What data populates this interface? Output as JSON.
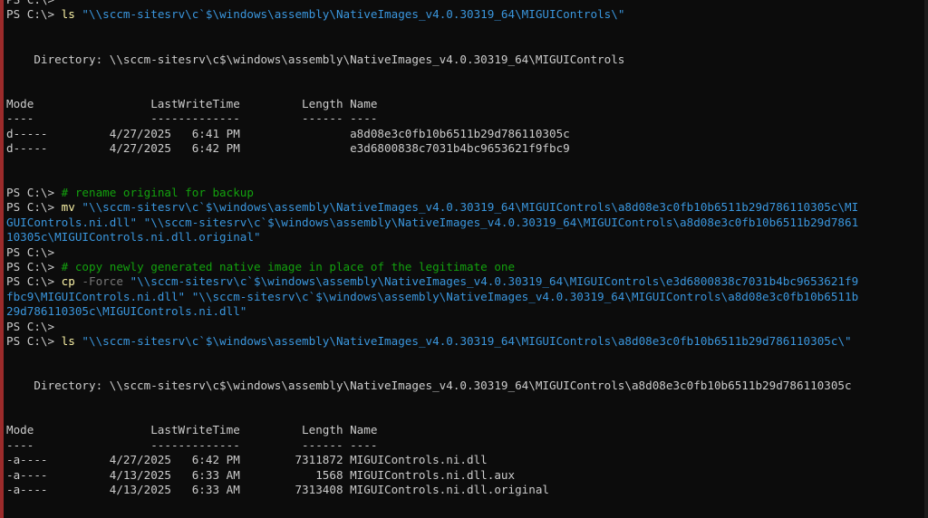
{
  "terminal": {
    "colors": {
      "background": "#0c0c0c",
      "text": "#cccccc",
      "command": "#f9f1a5",
      "string": "#3a96dd",
      "comment": "#13a10e",
      "parameter": "#767676",
      "left_edge": "#9c2b2b"
    },
    "lines": [
      {
        "spans": [
          {
            "t": "prompt",
            "v": "PS C:\\>"
          }
        ]
      },
      {
        "spans": [
          {
            "t": "prompt",
            "v": "PS C:\\> "
          },
          {
            "t": "cmd",
            "v": "ls"
          },
          {
            "t": "str",
            "v": " \"\\\\sccm-sitesrv\\c`$\\windows\\assembly\\NativeImages_v4.0.30319_64\\MIGUIControls\\\""
          }
        ]
      },
      {
        "spans": []
      },
      {
        "spans": []
      },
      {
        "spans": [
          {
            "t": "plain",
            "v": "    Directory: \\\\sccm-sitesrv\\c$\\windows\\assembly\\NativeImages_v4.0.30319_64\\MIGUIControls"
          }
        ]
      },
      {
        "spans": []
      },
      {
        "spans": []
      },
      {
        "spans": [
          {
            "t": "plain",
            "v": "Mode                 LastWriteTime         Length Name"
          }
        ]
      },
      {
        "spans": [
          {
            "t": "plain",
            "v": "----                 -------------         ------ ----"
          }
        ]
      },
      {
        "spans": [
          {
            "t": "plain",
            "v": "d-----         4/27/2025   6:41 PM                a8d08e3c0fb10b6511b29d786110305c"
          }
        ]
      },
      {
        "spans": [
          {
            "t": "plain",
            "v": "d-----         4/27/2025   6:42 PM                e3d6800838c7031b4bc9653621f9fbc9"
          }
        ]
      },
      {
        "spans": []
      },
      {
        "spans": []
      },
      {
        "spans": [
          {
            "t": "prompt",
            "v": "PS C:\\> "
          },
          {
            "t": "comment",
            "v": "# rename original for backup"
          }
        ]
      },
      {
        "spans": [
          {
            "t": "prompt",
            "v": "PS C:\\> "
          },
          {
            "t": "cmd",
            "v": "mv"
          },
          {
            "t": "str",
            "v": " \"\\\\sccm-sitesrv\\c`$\\windows\\assembly\\NativeImages_v4.0.30319_64\\MIGUIControls\\a8d08e3c0fb10b6511b29d786110305c\\MI"
          }
        ]
      },
      {
        "spans": [
          {
            "t": "str",
            "v": "GUIControls.ni.dll\" \"\\\\sccm-sitesrv\\c`$\\windows\\assembly\\NativeImages_v4.0.30319_64\\MIGUIControls\\a8d08e3c0fb10b6511b29d7861"
          }
        ]
      },
      {
        "spans": [
          {
            "t": "str",
            "v": "10305c\\MIGUIControls.ni.dll.original\""
          }
        ]
      },
      {
        "spans": [
          {
            "t": "prompt",
            "v": "PS C:\\>"
          }
        ]
      },
      {
        "spans": [
          {
            "t": "prompt",
            "v": "PS C:\\> "
          },
          {
            "t": "comment",
            "v": "# copy newly generated native image in place of the legitimate one"
          }
        ]
      },
      {
        "spans": [
          {
            "t": "prompt",
            "v": "PS C:\\> "
          },
          {
            "t": "cmd",
            "v": "cp"
          },
          {
            "t": "param",
            "v": " -Force"
          },
          {
            "t": "str",
            "v": " \"\\\\sccm-sitesrv\\c`$\\windows\\assembly\\NativeImages_v4.0.30319_64\\MIGUIControls\\e3d6800838c7031b4bc9653621f9"
          }
        ]
      },
      {
        "spans": [
          {
            "t": "str",
            "v": "fbc9\\MIGUIControls.ni.dll\" \"\\\\sccm-sitesrv\\c`$\\windows\\assembly\\NativeImages_v4.0.30319_64\\MIGUIControls\\a8d08e3c0fb10b6511b"
          }
        ]
      },
      {
        "spans": [
          {
            "t": "str",
            "v": "29d786110305c\\MIGUIControls.ni.dll\""
          }
        ]
      },
      {
        "spans": [
          {
            "t": "prompt",
            "v": "PS C:\\>"
          }
        ]
      },
      {
        "spans": [
          {
            "t": "prompt",
            "v": "PS C:\\> "
          },
          {
            "t": "cmd",
            "v": "ls"
          },
          {
            "t": "str",
            "v": " \"\\\\sccm-sitesrv\\c`$\\windows\\assembly\\NativeImages_v4.0.30319_64\\MIGUIControls\\a8d08e3c0fb10b6511b29d786110305c\\\""
          }
        ]
      },
      {
        "spans": []
      },
      {
        "spans": []
      },
      {
        "spans": [
          {
            "t": "plain",
            "v": "    Directory: \\\\sccm-sitesrv\\c$\\windows\\assembly\\NativeImages_v4.0.30319_64\\MIGUIControls\\a8d08e3c0fb10b6511b29d786110305c"
          }
        ]
      },
      {
        "spans": []
      },
      {
        "spans": []
      },
      {
        "spans": [
          {
            "t": "plain",
            "v": "Mode                 LastWriteTime         Length Name"
          }
        ]
      },
      {
        "spans": [
          {
            "t": "plain",
            "v": "----                 -------------         ------ ----"
          }
        ]
      },
      {
        "spans": [
          {
            "t": "plain",
            "v": "-a----         4/27/2025   6:42 PM        7311872 MIGUIControls.ni.dll"
          }
        ]
      },
      {
        "spans": [
          {
            "t": "plain",
            "v": "-a----         4/13/2025   6:33 AM           1568 MIGUIControls.ni.dll.aux"
          }
        ]
      },
      {
        "spans": [
          {
            "t": "plain",
            "v": "-a----         4/13/2025   6:33 AM        7313408 MIGUIControls.ni.dll.original"
          }
        ]
      }
    ]
  }
}
